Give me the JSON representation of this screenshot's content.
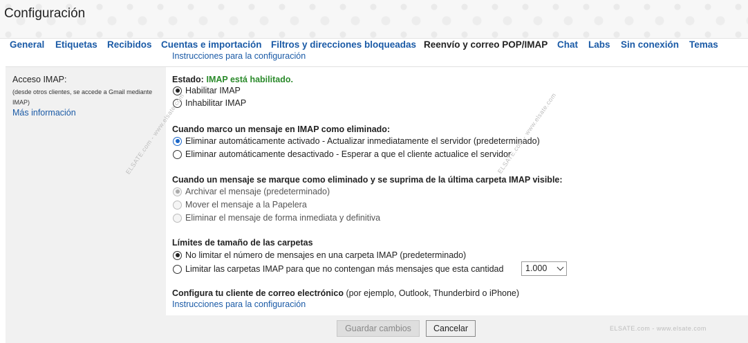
{
  "page": {
    "title": "Configuración"
  },
  "tabs": [
    {
      "label": "General"
    },
    {
      "label": "Etiquetas"
    },
    {
      "label": "Recibidos"
    },
    {
      "label": "Cuentas e importación"
    },
    {
      "label": "Filtros y direcciones bloqueadas"
    },
    {
      "label": "Reenvío y correo POP/IMAP",
      "active": true
    },
    {
      "label": "Chat"
    },
    {
      "label": "Labs"
    },
    {
      "label": "Sin conexión"
    },
    {
      "label": "Temas"
    }
  ],
  "top_link": "Instrucciones para la configuración",
  "imap_section": {
    "title": "Acceso IMAP:",
    "description": "(desde otros clientes, se accede a Gmail mediante IMAP)",
    "more_info": "Más información",
    "status_label": "Estado:",
    "status_value": "IMAP está habilitado.",
    "enable_option": "Habilitar IMAP",
    "disable_option": "Inhabilitar IMAP"
  },
  "delete_section": {
    "title": "Cuando marco un mensaje en IMAP como eliminado:",
    "options": [
      "Eliminar automáticamente activado - Actualizar inmediatamente el servidor (predeterminado)",
      "Eliminar automáticamente desactivado - Esperar a que el cliente actualice el servidor"
    ]
  },
  "expunge_section": {
    "title": "Cuando un mensaje se marque como eliminado y se suprima de la última carpeta IMAP visible:",
    "options": [
      "Archivar el mensaje (predeterminado)",
      "Mover el mensaje a la Papelera",
      "Eliminar el mensaje de forma inmediata y definitiva"
    ]
  },
  "folder_limits": {
    "title": "Límites de tamaño de las carpetas",
    "options": [
      "No limitar el número de mensajes en una carpeta IMAP (predeterminado)",
      "Limitar las carpetas IMAP para que no contengan más mensajes que esta cantidad"
    ],
    "selected_count": "1.000"
  },
  "client_config": {
    "title": "Configura tu cliente de correo electrónico",
    "subtitle": " (por ejemplo, Outlook, Thunderbird o iPhone)",
    "link": "Instrucciones para la configuración"
  },
  "buttons": {
    "save": "Guardar cambios",
    "cancel": "Cancelar"
  },
  "watermarks": {
    "left": "ELSATE.com - www.elsate.com",
    "middle": "ELSATE.com - www.elsate.com",
    "bottom": "ELSATE.com - www.elsate.com"
  },
  "colors": {
    "link": "#1a5aa6",
    "status_green": "#2a8a2a",
    "panel": "#f1f1f1"
  }
}
